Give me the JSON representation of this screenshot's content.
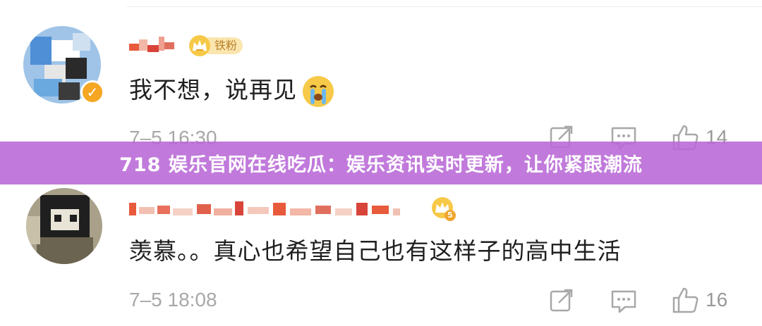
{
  "comments": [
    {
      "badge_label": "铁粉",
      "text": "我不想，说再见",
      "time": "7–5 16:30",
      "like_count": "14"
    },
    {
      "badge_level": "5",
      "text": "羡慕。。真心也希望自己也有这样子的高中生活",
      "time": "7–5 18:08",
      "like_count": "16"
    }
  ],
  "banner": {
    "text": "718 娱乐官网在线吃瓜：娱乐资讯实时更新，让你紧跟潮流"
  },
  "icons": [
    "verified-icon",
    "crown-icon",
    "crying-emoji-icon",
    "repost-icon",
    "comment-icon",
    "like-icon"
  ],
  "colors": {
    "banner_bg": "#b868d6",
    "badge_gold": "#f7c948",
    "muted_gray": "#a8a8a8"
  }
}
